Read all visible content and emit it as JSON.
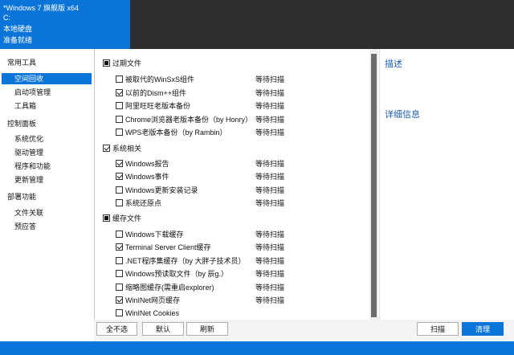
{
  "header": {
    "os_name": "*Windows 7 旗舰版 x64",
    "drive": "C:",
    "disk_type": "本地硬盘",
    "status": "准备就绪"
  },
  "sidebar": {
    "categories": [
      {
        "label": "常用工具",
        "items": [
          "空间回收",
          "启动项管理",
          "工具箱"
        ]
      },
      {
        "label": "控制面板",
        "items": [
          "系统优化",
          "驱动管理",
          "程序和功能",
          "更新管理"
        ]
      },
      {
        "label": "部署功能",
        "items": [
          "文件关联",
          "预应答"
        ]
      }
    ],
    "selected": "空间回收"
  },
  "cleanup_groups": [
    {
      "label": "过期文件",
      "state": "partial",
      "items": [
        {
          "label": "被取代的WinSxS组件",
          "checked": false,
          "status": "等待扫描"
        },
        {
          "label": "以前的Dism++组件",
          "checked": true,
          "status": "等待扫描"
        },
        {
          "label": "阿里旺旺老版本备份",
          "checked": false,
          "status": "等待扫描"
        },
        {
          "label": "Chrome浏览器老版本备份（by Honry）",
          "checked": false,
          "status": "等待扫描"
        },
        {
          "label": "WPS老版本备份（by Rambin）",
          "checked": false,
          "status": "等待扫描"
        }
      ]
    },
    {
      "label": "系统相关",
      "state": "checked",
      "items": [
        {
          "label": "Windows报告",
          "checked": true,
          "status": "等待扫描"
        },
        {
          "label": "Windows事件",
          "checked": true,
          "status": "等待扫描"
        },
        {
          "label": "Windows更新安装记录",
          "checked": false,
          "status": "等待扫描"
        },
        {
          "label": "系统还原点",
          "checked": false,
          "status": "等待扫描"
        }
      ]
    },
    {
      "label": "缓存文件",
      "state": "partial",
      "items": [
        {
          "label": "Windows下载缓存",
          "checked": false,
          "status": "等待扫描"
        },
        {
          "label": "Terminal Server Client缓存",
          "checked": true,
          "status": "等待扫描"
        },
        {
          "label": ".NET程序集缓存（by 大胖子技术员）",
          "checked": false,
          "status": "等待扫描"
        },
        {
          "label": "Windows预读取文件（by 辰g.）",
          "checked": false,
          "status": "等待扫描"
        },
        {
          "label": "缩略图缓存(需重启explorer)",
          "checked": false,
          "status": "等待扫描"
        },
        {
          "label": "WinINet网页缓存",
          "checked": true,
          "status": "等待扫描"
        },
        {
          "label": "WinINet Cookies",
          "checked": false,
          "status": ""
        }
      ]
    }
  ],
  "details": {
    "description_heading": "描述",
    "detail_heading": "详细信息"
  },
  "buttons": {
    "deselect_all": "全不选",
    "default": "默认",
    "refresh": "刷新",
    "scan": "扫描",
    "clean": "清理"
  },
  "colors": {
    "accent": "#0b74d8",
    "titlebar": "#2e2e2e"
  }
}
